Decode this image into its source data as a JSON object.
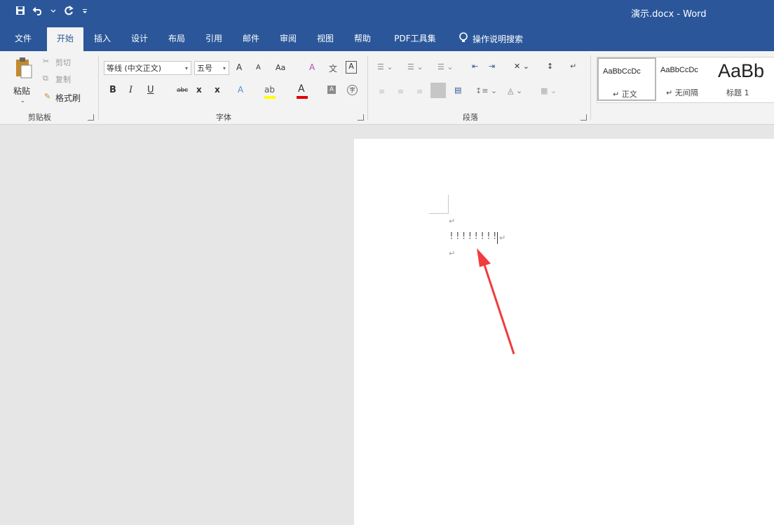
{
  "title_bar": {
    "doc_title": "演示.docx  -  Word",
    "icons": [
      "save-icon",
      "undo-icon",
      "redo-icon",
      "customize-qat-icon"
    ]
  },
  "tabs": [
    {
      "label": "文件"
    },
    {
      "label": "开始"
    },
    {
      "label": "插入"
    },
    {
      "label": "设计"
    },
    {
      "label": "布局"
    },
    {
      "label": "引用"
    },
    {
      "label": "邮件"
    },
    {
      "label": "审阅"
    },
    {
      "label": "视图"
    },
    {
      "label": "帮助"
    },
    {
      "label": "PDF工具集"
    }
  ],
  "active_tab": "开始",
  "tell_me": {
    "label": "操作说明搜索",
    "icon": "lightbulb-icon"
  },
  "clipboard": {
    "paste": "粘贴",
    "cut": "剪切",
    "copy": "复制",
    "format_painter": "格式刷",
    "group_label": "剪贴板"
  },
  "font": {
    "font_name": "等线 (中文正文)",
    "font_size": "五号",
    "grow": "A",
    "shrink": "A",
    "case": "Aa",
    "bold": "B",
    "italic": "I",
    "underline": "U",
    "strike": "abc",
    "subscript": "x",
    "superscript": "x",
    "font_color": "A",
    "group_label": "字体"
  },
  "paragraph": {
    "group_label": "段落"
  },
  "styles": [
    {
      "sample": "AaBbCcDc",
      "name": "↵ 正文"
    },
    {
      "sample": "AaBbCcDc",
      "name": "↵ 无间隔"
    },
    {
      "sample": "AaBb",
      "name": "标题 1"
    }
  ],
  "document": {
    "line_text": "!!!!!!!!",
    "paragraph_mark": "↵"
  },
  "colors": {
    "accent": "#2b579a",
    "highlight": "#ffff00",
    "font_color": "#e00000",
    "arrow": "#f03c3c"
  }
}
